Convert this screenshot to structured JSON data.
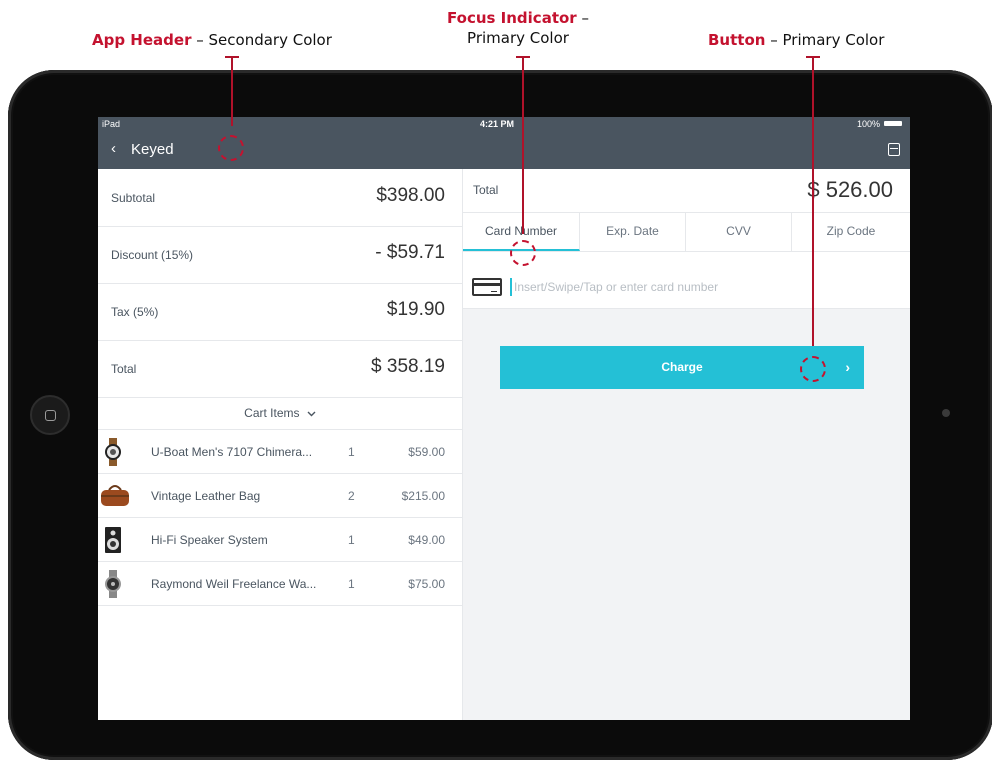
{
  "callouts": {
    "app_header": {
      "title": "App Header",
      "desc": "Secondary Color"
    },
    "focus_indicator": {
      "title": "Focus Indicator",
      "desc": "Primary Color"
    },
    "button": {
      "title": "Button",
      "desc": "Primary Color"
    },
    "dash": "–"
  },
  "statusbar": {
    "carrier": "iPad",
    "time": "4:21 PM",
    "battery": "100%"
  },
  "header": {
    "back": "‹",
    "title": "Keyed"
  },
  "summary": [
    {
      "label": "Subtotal",
      "value": "$398.00"
    },
    {
      "label": "Discount (15%)",
      "value": "- $59.71"
    },
    {
      "label": "Tax (5%)",
      "value": "$19.90"
    },
    {
      "label": "Total",
      "value": "$ 358.19"
    }
  ],
  "cart": {
    "header": "Cart Items",
    "items": [
      {
        "name": "U-Boat Men's 7107 Chimera...",
        "qty": "1",
        "price": "$59.00",
        "thumb": "watch-icon"
      },
      {
        "name": "Vintage Leather Bag",
        "qty": "2",
        "price": "$215.00",
        "thumb": "bag-icon"
      },
      {
        "name": "Hi-Fi Speaker System",
        "qty": "1",
        "price": "$49.00",
        "thumb": "speaker-icon"
      },
      {
        "name": "Raymond Weil Freelance Wa...",
        "qty": "1",
        "price": "$75.00",
        "thumb": "watch-icon"
      }
    ]
  },
  "payment": {
    "total_label": "Total",
    "total_value": "$ 526.00",
    "tabs": [
      "Card Number",
      "Exp. Date",
      "CVV",
      "Zip Code"
    ],
    "active_tab": "Card Number",
    "card_placeholder": "Insert/Swipe/Tap or enter card number",
    "charge_label": "Charge",
    "charge_chevron": "›"
  },
  "colors": {
    "primary": "#24c0d6",
    "secondary": "#4a5560",
    "callout_red": "#c4122f"
  }
}
